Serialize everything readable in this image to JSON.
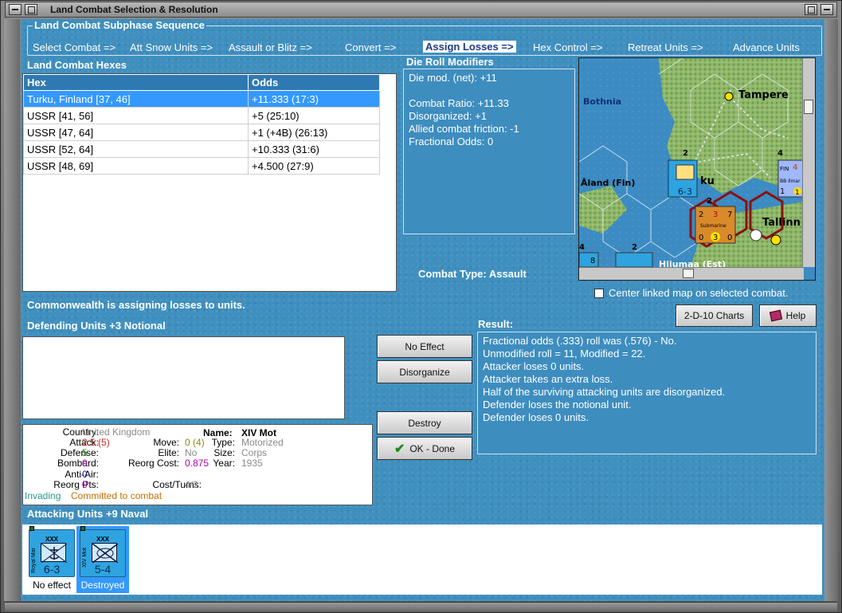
{
  "window": {
    "title": "Land Combat Selection & Resolution"
  },
  "subphase": {
    "title": "Land Combat Subphase Sequence",
    "steps": [
      {
        "label": "Select Combat =>"
      },
      {
        "label": "Att Snow Units =>"
      },
      {
        "label": "Assault or Blitz =>"
      },
      {
        "label": "Convert =>"
      },
      {
        "label": "Assign Losses =>"
      },
      {
        "label": "Hex Control =>"
      },
      {
        "label": "Retreat Units =>"
      },
      {
        "label": "Advance Units"
      }
    ],
    "active_index": 4
  },
  "hexes": {
    "title": "Land Combat Hexes",
    "columns": [
      "Hex",
      "Odds"
    ],
    "rows": [
      {
        "hex": "Turku, Finland [37, 46]",
        "odds": "+11.333 (17:3)",
        "selected": true
      },
      {
        "hex": "USSR [41, 56]",
        "odds": "+5 (25:10)"
      },
      {
        "hex": "USSR [47, 64]",
        "odds": "+1 (+4B) (26:13)"
      },
      {
        "hex": "USSR [52, 64]",
        "odds": "+10.333 (31:6)"
      },
      {
        "hex": "USSR [48, 69]",
        "odds": "+4.500 (27:9)"
      }
    ]
  },
  "drm": {
    "title": "Die Roll Modifiers",
    "lines": [
      "Die mod. (net): +11",
      "",
      "Combat Ratio: +11.33",
      "Disorganized: +1",
      "Allied combat friction: -1",
      "Fractional Odds: 0"
    ]
  },
  "map": {
    "labels": {
      "bothnia": "Bothnia",
      "tampere": "Tampere",
      "aland": "Åland (Fin)",
      "turku": "ku",
      "tallinn": "Tallinn",
      "hiiumaa": "Hiiumaa (Est)",
      "submarine": "Submarine"
    },
    "counters": {
      "main_value": "6-3",
      "stack2": "2",
      "stack4": "4",
      "stack2b": "2",
      "fin_label": "FIN",
      "bb_label": "BB Ilmar",
      "sub_top": [
        "2",
        "3",
        "7"
      ],
      "sub_bottom": [
        "0",
        "3",
        "0"
      ],
      "fin_vals": [
        "1",
        "4",
        "1",
        "1"
      ],
      "edge8": "8",
      "edge4": "4"
    },
    "center_linked_label": "Center linked map on selected combat."
  },
  "combat_type": {
    "label": "Combat Type:",
    "value": "Assault"
  },
  "status_message": "Commonwealth is assigning losses to units.",
  "defending": {
    "title": "Defending Units +3 Notional"
  },
  "buttons": {
    "no_effect": "No Effect",
    "disorganize": "Disorganize",
    "destroy": "Destroy",
    "ok_done": "OK - Done",
    "charts": "2-D-10 Charts",
    "help": "Help"
  },
  "result": {
    "title": "Result:",
    "lines": [
      "Fractional odds (.333) roll was (.576)  - No.",
      "Unmodified roll = 11, Modified = 22.",
      "Attacker loses 0 units.",
      "Attacker takes an extra loss.",
      "Half of the surviving attacking units are disorganized.",
      "Defender loses the notional unit.",
      "Defender loses 0 units."
    ]
  },
  "unit_info": {
    "country_label": "Country:",
    "country": "United Kingdom",
    "name_label": "Name:",
    "name": "XIV Mot",
    "attack_label": "Attack:",
    "attack": "2.5",
    "attack_base": "(5)",
    "move_label": "Move:",
    "move": "0",
    "move_base": "(4)",
    "type_label": "Type:",
    "type": "Motorized",
    "defense_label": "Defense:",
    "defense": "5",
    "elite_label": "Elite:",
    "elite": "No",
    "size_label": "Size:",
    "size": "Corps",
    "bombard_label": "Bombard:",
    "bombard": "0",
    "reorg_cost_label": "Reorg Cost:",
    "reorg_cost": "0.875",
    "year_label": "Year:",
    "year": "1935",
    "antiair_label": "Anti-Air:",
    "antiair": "0",
    "reorg_pts_label": "Reorg Pts:",
    "reorg_pts": "0",
    "cost_turns_label": "Cost/Turns:",
    "cost_turns": "4/3",
    "invading": "Invading",
    "committed": "Committed to combat"
  },
  "attacking": {
    "title": "Attacking Units +9 Naval",
    "units": [
      {
        "name": "Royal Mar",
        "size": "XXX",
        "value": "6-3",
        "status": "No effect",
        "selected": false
      },
      {
        "name": "XIV Mot",
        "size": "XXX",
        "value": "5-4",
        "status": "Destroyed",
        "selected": true
      }
    ]
  }
}
